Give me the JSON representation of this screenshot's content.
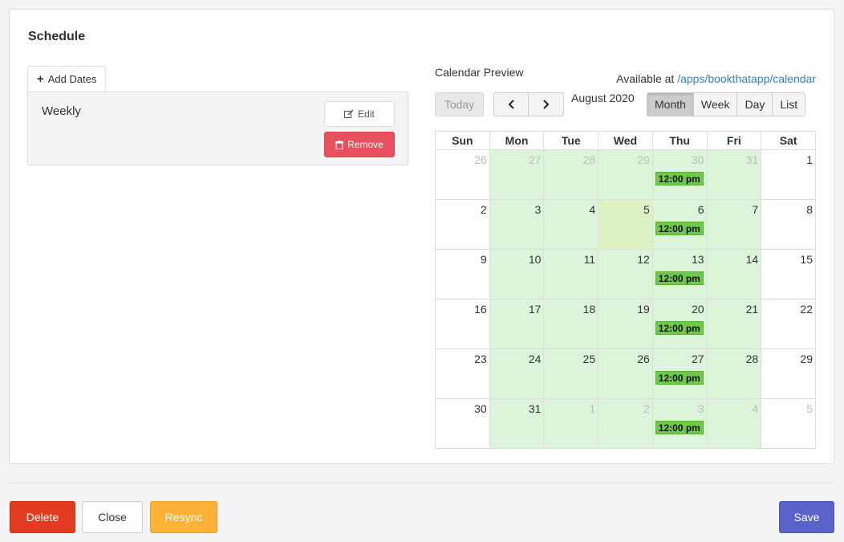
{
  "schedule": {
    "title": "Schedule",
    "add_dates_label": "Add Dates",
    "item": {
      "name": "Weekly",
      "edit_label": "Edit",
      "remove_label": "Remove"
    }
  },
  "calendar": {
    "label": "Calendar Preview",
    "available_prefix": "Available at ",
    "available_link": "/apps/bookthatapp/calendar",
    "today_label": "Today",
    "title": "August 2020",
    "views": [
      "Month",
      "Week",
      "Day",
      "List"
    ],
    "active_view": "Month",
    "weekdays": [
      "Sun",
      "Mon",
      "Tue",
      "Wed",
      "Thu",
      "Fri",
      "Sat"
    ],
    "event_label": "12:00 pm",
    "weeks": [
      [
        {
          "d": "26",
          "o": true
        },
        {
          "d": "27",
          "o": true,
          "a": true
        },
        {
          "d": "28",
          "o": true,
          "a": true
        },
        {
          "d": "29",
          "o": true,
          "a": true
        },
        {
          "d": "30",
          "o": true,
          "a": true,
          "e": true
        },
        {
          "d": "31",
          "o": true,
          "a": true
        },
        {
          "d": "1"
        }
      ],
      [
        {
          "d": "2"
        },
        {
          "d": "3",
          "a": true
        },
        {
          "d": "4",
          "a": true
        },
        {
          "d": "5",
          "t": true
        },
        {
          "d": "6",
          "a": true,
          "e": true
        },
        {
          "d": "7",
          "a": true
        },
        {
          "d": "8"
        }
      ],
      [
        {
          "d": "9"
        },
        {
          "d": "10",
          "a": true
        },
        {
          "d": "11",
          "a": true
        },
        {
          "d": "12",
          "a": true
        },
        {
          "d": "13",
          "a": true,
          "e": true
        },
        {
          "d": "14",
          "a": true
        },
        {
          "d": "15"
        }
      ],
      [
        {
          "d": "16"
        },
        {
          "d": "17",
          "a": true
        },
        {
          "d": "18",
          "a": true
        },
        {
          "d": "19",
          "a": true
        },
        {
          "d": "20",
          "a": true,
          "e": true
        },
        {
          "d": "21",
          "a": true
        },
        {
          "d": "22"
        }
      ],
      [
        {
          "d": "23"
        },
        {
          "d": "24",
          "a": true
        },
        {
          "d": "25",
          "a": true
        },
        {
          "d": "26",
          "a": true
        },
        {
          "d": "27",
          "a": true,
          "e": true
        },
        {
          "d": "28",
          "a": true
        },
        {
          "d": "29"
        }
      ],
      [
        {
          "d": "30"
        },
        {
          "d": "31",
          "a": true
        },
        {
          "d": "1",
          "o": true,
          "a": true
        },
        {
          "d": "2",
          "o": true,
          "a": true
        },
        {
          "d": "3",
          "o": true,
          "a": true,
          "e": true
        },
        {
          "d": "4",
          "o": true,
          "a": true
        },
        {
          "d": "5",
          "o": true
        }
      ]
    ]
  },
  "footer": {
    "delete_label": "Delete",
    "close_label": "Close",
    "resync_label": "Resync",
    "save_label": "Save"
  },
  "colors": {
    "available_day": "#dcf5da",
    "today_day": "#dcf2c2",
    "event": "#6ec84a",
    "delete": "#e33b1f",
    "resync": "#fbb237",
    "save": "#5a63c9",
    "remove": "#e9505e",
    "link": "#3a7dc3"
  }
}
